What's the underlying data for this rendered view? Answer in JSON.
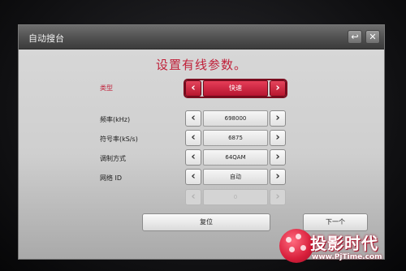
{
  "window": {
    "title": "自动搜台",
    "back_icon": "↩",
    "close_icon": "✕"
  },
  "heading": "设置有线参数。",
  "rows": [
    {
      "label": "类型",
      "value": "快速",
      "active": true
    },
    {
      "label": "频率(kHz)",
      "value": "698000"
    },
    {
      "label": "符号率(kS/s)",
      "value": "6875"
    },
    {
      "label": "调制方式",
      "value": "64QAM"
    },
    {
      "label": "网络 ID",
      "value": "自动"
    },
    {
      "label": "",
      "value": "0",
      "disabled": true
    }
  ],
  "arrows": {
    "left": "‹",
    "right": "›"
  },
  "buttons": {
    "reset": "复位",
    "next": "下一个"
  },
  "watermark": {
    "name": "投影时代",
    "url": "www.PjTime.com"
  },
  "colors": {
    "accent": "#c0213a",
    "dialog": "#d6d6d6",
    "titlebar": "#555555"
  }
}
